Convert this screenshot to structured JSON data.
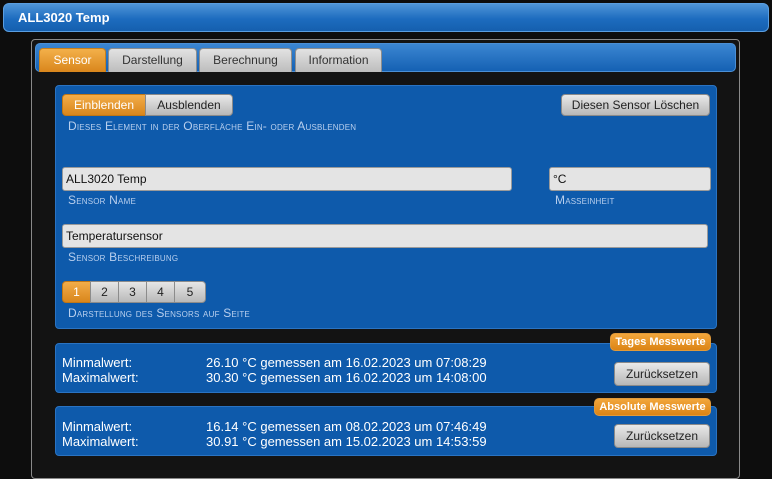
{
  "window": {
    "title": "ALL3020 Temp"
  },
  "tabs": [
    {
      "label": "Sensor"
    },
    {
      "label": "Darstellung"
    },
    {
      "label": "Berechnung"
    },
    {
      "label": "Information"
    }
  ],
  "visibility": {
    "show_label": "Einblenden",
    "hide_label": "Ausblenden",
    "description": "Dieses Element in der Oberfläche Ein- oder Ausblenden",
    "selected": "Einblenden"
  },
  "delete_button": "Diesen Sensor Löschen",
  "sensor_name": {
    "value": "ALL3020 Temp",
    "label": "Sensor Name"
  },
  "unit": {
    "value": "°C",
    "label": "Maßeinheit"
  },
  "description_field": {
    "value": "Temperatursensor",
    "label": "Sensor Beschreibung"
  },
  "page_selector": {
    "pages": [
      "1",
      "2",
      "3",
      "4",
      "5"
    ],
    "selected": "1",
    "label": "Darstellung des Sensors auf Seite"
  },
  "daily": {
    "badge": "Tages Messwerte",
    "min_label": "Minmalwert:",
    "min_value": "26.10 °C gemessen am 16.02.2023 um 07:08:29",
    "max_label": "Maximalwert:",
    "max_value": "30.30 °C gemessen am 16.02.2023 um 14:08:00",
    "reset": "Zurücksetzen"
  },
  "absolute": {
    "badge": "Absolute Messwerte",
    "min_label": "Minmalwert:",
    "min_value": "16.14 °C gemessen am 08.02.2023 um 07:46:49",
    "max_label": "Maximalwert:",
    "max_value": "30.91 °C gemessen am 15.02.2023 um 14:53:59",
    "reset": "Zurücksetzen"
  },
  "colors": {
    "accent": "#e08a1e",
    "card": "#0e5aab",
    "titlebar": "#1d6cbf"
  }
}
